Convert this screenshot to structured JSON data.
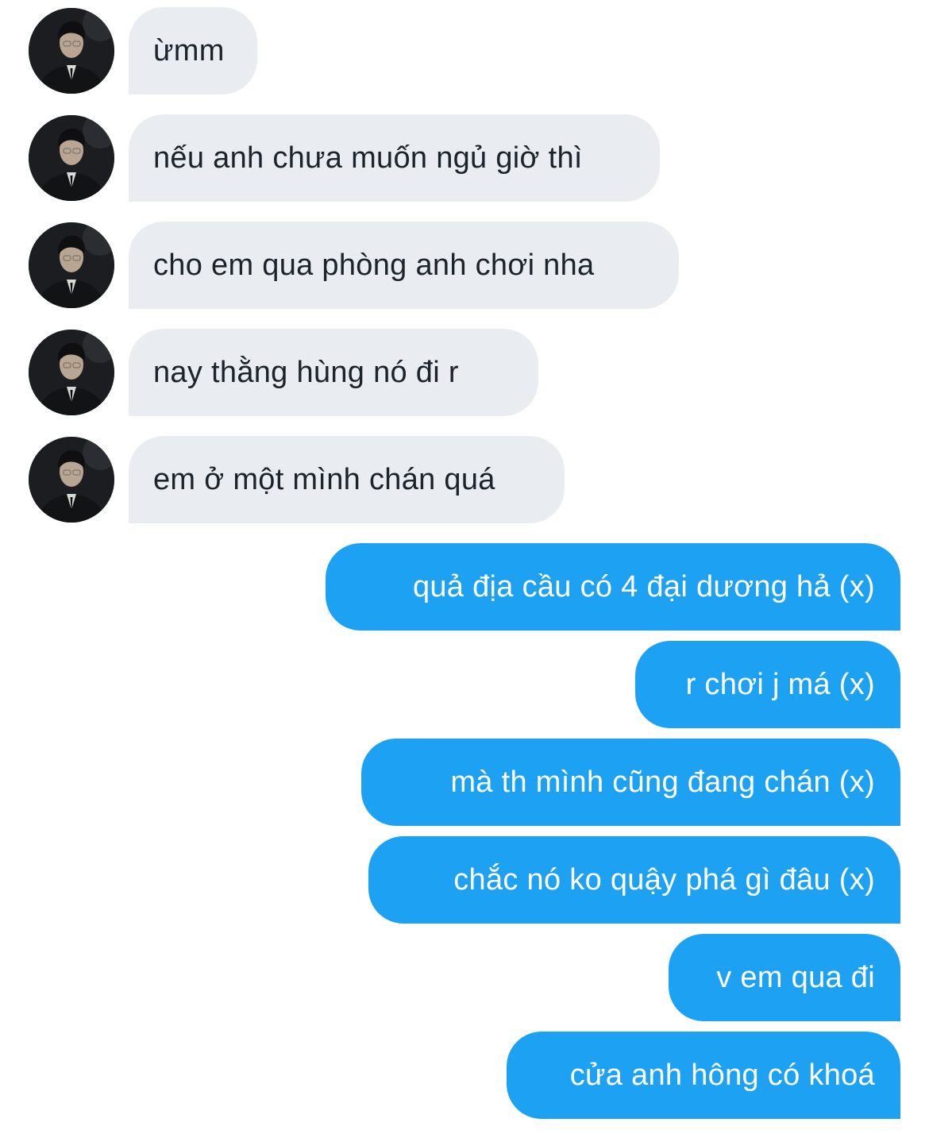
{
  "conversation": {
    "avatar": {
      "icon": "profile-photo",
      "description": ""
    },
    "incoming": [
      {
        "text": "ừmm"
      },
      {
        "text": "nếu anh chưa muốn ngủ giờ thì"
      },
      {
        "text": "cho em qua phòng anh chơi nha"
      },
      {
        "text": "nay thằng hùng nó đi r"
      },
      {
        "text": "em ở một mình chán quá"
      }
    ],
    "outgoing": [
      {
        "text": "quả địa cầu có 4 đại dương hả (x)"
      },
      {
        "text": "r chơi j má (x)"
      },
      {
        "text": "mà th mình cũng đang chán (x)"
      },
      {
        "text": "chắc nó ko quậy phá gì đâu (x)"
      },
      {
        "text": "v em qua đi"
      },
      {
        "text": "cửa anh hông có khoá"
      }
    ],
    "colors": {
      "incoming_bubble": "#e9edf1",
      "incoming_text": "#1b232b",
      "outgoing_bubble": "#1da1f2",
      "outgoing_text": "#ffffff",
      "background": "#ffffff"
    }
  }
}
